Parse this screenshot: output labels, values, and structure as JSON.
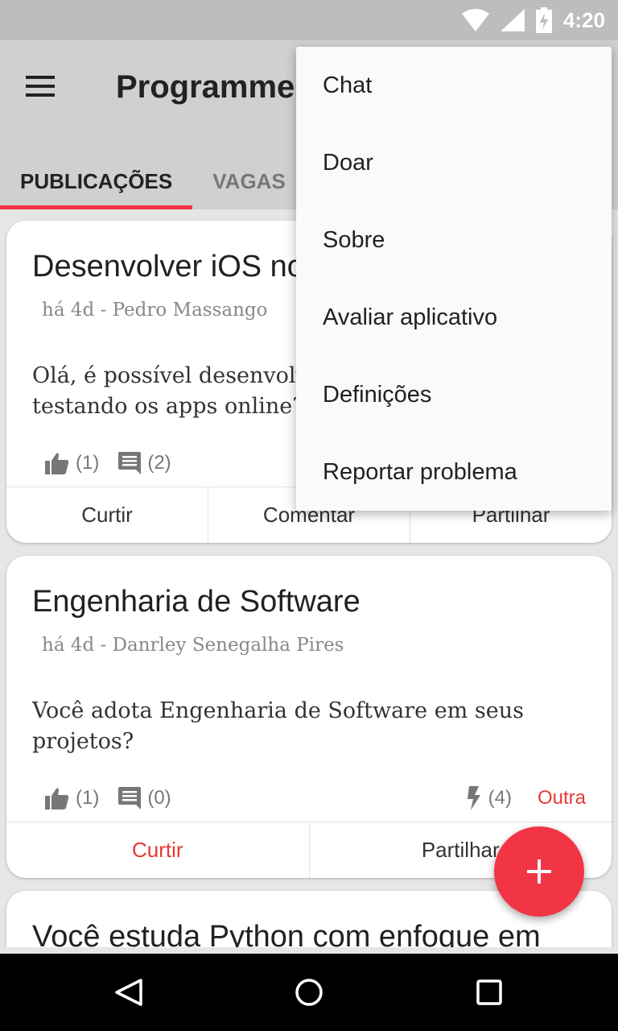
{
  "status_bar": {
    "time": "4:20"
  },
  "app_bar": {
    "title": "Programmers"
  },
  "tabs": [
    {
      "label": "PUBLICAÇÕES",
      "active": true
    },
    {
      "label": "VAGAS",
      "active": false
    }
  ],
  "overflow_menu": {
    "items": [
      "Chat",
      "Doar",
      "Sobre",
      "Avaliar aplicativo",
      "Definições",
      "Reportar problema"
    ]
  },
  "posts": [
    {
      "title": "Desenvolver iOS no Windows",
      "meta": "há 4d - Pedro Massango",
      "body": "Olá, é possível desenvolver para iOS no Windows testando os apps online?",
      "likes": "(1)",
      "comments": "(2)",
      "actions": [
        "Curtir",
        "Comentar",
        "Partilhar"
      ]
    },
    {
      "title": "Engenharia de Software",
      "meta": "há 4d - Danrley Senegalha Pires",
      "body": "Você adota Engenharia de Software em seus projetos?",
      "likes": "(1)",
      "comments": "(0)",
      "bolts": "(4)",
      "tag": "Outra",
      "actions": [
        "Curtir",
        "Partilhar"
      ]
    },
    {
      "title": "Você estuda Python com enfoque em"
    }
  ],
  "fab": {
    "label": "+"
  },
  "colors": {
    "accent": "#f23545",
    "status_bar": "#bdbdbd",
    "app_bar": "#d0d0d0"
  }
}
